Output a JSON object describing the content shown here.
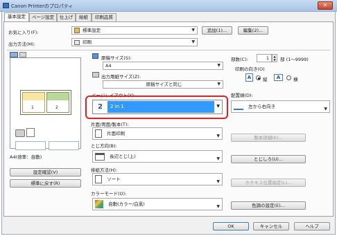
{
  "window": {
    "title": "Canon Printerのプロパティ",
    "close": "✕"
  },
  "tabs": [
    "基本設定",
    "ページ設定",
    "仕上げ",
    "給紙",
    "印刷品質"
  ],
  "favorites": {
    "label": "お気に入り(F):",
    "value": "標準設定",
    "add": "追加(1)...",
    "edit": "編集(2)..."
  },
  "output_method": {
    "label": "出力方法(M):",
    "value": "印刷"
  },
  "left": {
    "preview_pages": [
      "1",
      "2"
    ],
    "paper_info": "A4(倍率：自動)",
    "confirm_settings": "設定確認(V)",
    "restore_defaults": "標準に戻す(R)"
  },
  "original_size": {
    "label": "原稿サイズ(S):",
    "value": "A4"
  },
  "output_size": {
    "label": "出力用紙サイズ(Z):",
    "value": "原稿サイズと同じ"
  },
  "copies": {
    "label": "部数(C):",
    "value": "1",
    "unit": "部 (1〜9999)"
  },
  "orientation": {
    "label": "印刷の向き(O)",
    "portrait": "縦",
    "landscape": "横",
    "selected": "portrait"
  },
  "page_layout": {
    "label": "ページレイアウト(Y):",
    "icon_num": "2",
    "value": "2 in 1"
  },
  "page_order": {
    "label": "配置順(D):",
    "value": "左から右向き"
  },
  "duplex": {
    "label": "片面/両面/製本(T):",
    "value": "片面印刷",
    "detail": "製本詳細(K)..."
  },
  "binding": {
    "label": "とじ方向(B):",
    "value": "長辺とじ(上)",
    "margin": "とじしろ(U)..."
  },
  "output": {
    "label": "排紙方法(H):",
    "value": "ソート",
    "staple": "ホチキス位置指定(L)..."
  },
  "color_mode": {
    "label": "カラーモード(O):",
    "value": "自動(カラー/白黒)",
    "color_settings": "色調の設定(E)..."
  },
  "footer": {
    "ok": "OK",
    "cancel": "キャンセル",
    "help": "ヘルプ"
  },
  "colors": {
    "highlight_red": "#e02020",
    "select_blue": "#3399ff",
    "accent": "#3b73c9"
  }
}
